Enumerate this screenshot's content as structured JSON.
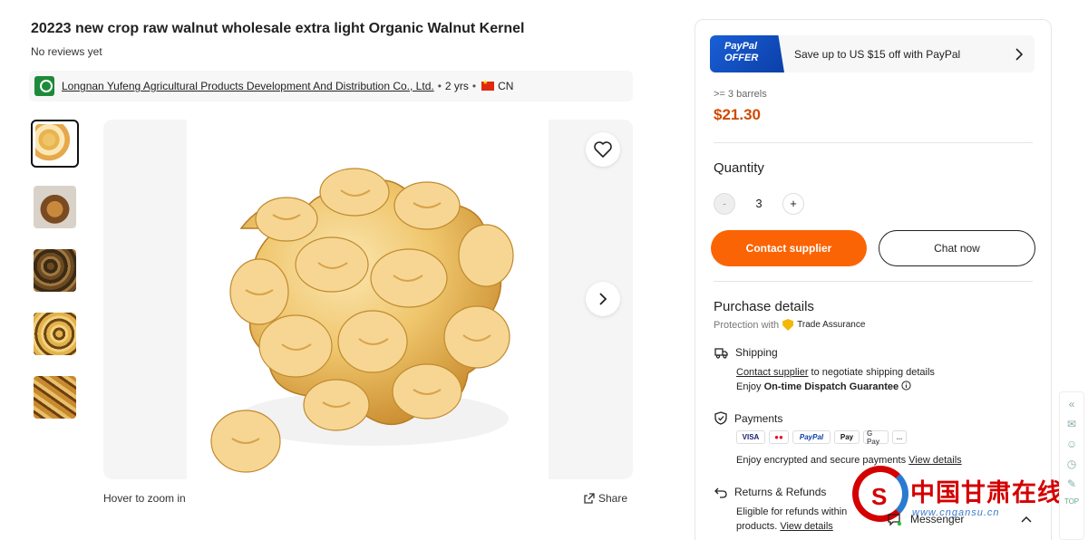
{
  "product": {
    "title": "20223 new crop raw walnut wholesale extra light Organic Walnut Kernel",
    "reviews": "No reviews yet"
  },
  "supplier": {
    "name": "Longnan Yufeng Agricultural Products Development And Distribution Co., Ltd.",
    "years": "2 yrs",
    "country": "CN"
  },
  "gallery": {
    "zoom_hint": "Hover to zoom in",
    "share_label": "Share",
    "thumbnail_count": 5,
    "active_thumbnail": 1
  },
  "offer": {
    "paypal_badge_line1": "PayPal",
    "paypal_badge_line2": "OFFER",
    "paypal_text": "Save up to US $15 off with PayPal"
  },
  "pricing": {
    "moq": ">= 3 barrels",
    "price": "$21.30"
  },
  "quantity": {
    "label": "Quantity",
    "value": "3",
    "minus": "-",
    "plus": "+"
  },
  "actions": {
    "contact_label": "Contact supplier",
    "chat_label": "Chat now"
  },
  "purchase": {
    "title": "Purchase details",
    "protection_prefix": "Protection with",
    "trade_assurance": "Trade Assurance",
    "shipping": {
      "heading": "Shipping",
      "link": "Contact supplier",
      "line1_rest": " to negotiate shipping details",
      "line2_prefix": "Enjoy ",
      "line2_bold": "On-time Dispatch Guarantee"
    },
    "payments": {
      "heading": "Payments",
      "methods": [
        "VISA",
        "●●",
        "PayPal",
        "Pay",
        "G Pay",
        "..."
      ],
      "text": "Enjoy encrypted and secure payments ",
      "link": "View details"
    },
    "refunds": {
      "heading": "Returns & Refunds",
      "line1": "Eligible for refunds within",
      "line2": "products. ",
      "link": "View details"
    }
  },
  "messenger": {
    "label": "Messenger"
  },
  "side_tools": {
    "top_label": "TOP"
  },
  "watermark": {
    "text": "中国甘肃在线",
    "url": "www.cngansu.cn",
    "logo_char": "S"
  },
  "colors": {
    "accent": "#fb6404",
    "price": "#d04a02",
    "paypal": "#1a5fd6",
    "watermark_red": "#d40000"
  }
}
